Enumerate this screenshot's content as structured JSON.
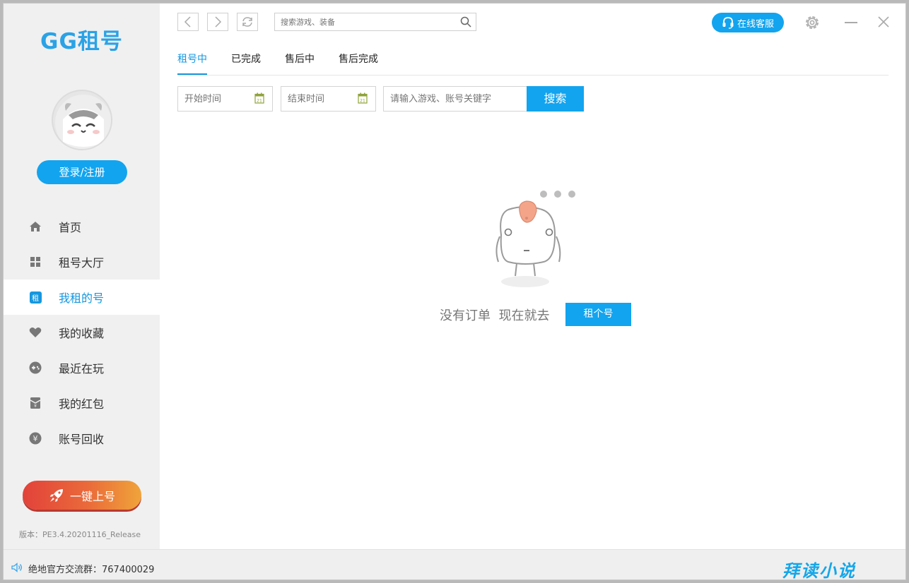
{
  "app": {
    "logo": "GG租号"
  },
  "sidebar": {
    "login_label": "登录/注册",
    "items": [
      {
        "label": "首页",
        "icon": "home-icon"
      },
      {
        "label": "租号大厅",
        "icon": "grid-icon"
      },
      {
        "label": "我租的号",
        "icon": "rent-icon",
        "active": true,
        "icon_text": "租"
      },
      {
        "label": "我的收藏",
        "icon": "heart-icon"
      },
      {
        "label": "最近在玩",
        "icon": "gamepad-icon"
      },
      {
        "label": "我的红包",
        "icon": "red-envelope-icon"
      },
      {
        "label": "账号回收",
        "icon": "yen-coin-icon"
      }
    ],
    "one_key_label": "一键上号",
    "version": "版本：PE3.4.20201116_Release"
  },
  "topbar": {
    "search_placeholder": "搜索游戏、装备",
    "service_label": "在线客服"
  },
  "tabs": [
    {
      "label": "租号中",
      "active": true
    },
    {
      "label": "已完成"
    },
    {
      "label": "售后中"
    },
    {
      "label": "售后完成"
    }
  ],
  "filter": {
    "start_placeholder": "开始时间",
    "end_placeholder": "结束时间",
    "calendar_day": "21",
    "keyword_placeholder": "请输入游戏、账号关键字",
    "search_label": "搜索"
  },
  "empty": {
    "message": "没有订单  现在就去",
    "button_label": "租个号"
  },
  "bottom": {
    "group_text": "绝地官方交流群：767400029",
    "watermark": "拜读小说"
  },
  "colors": {
    "accent": "#12a4ef",
    "sidebar_bg": "#f0f0f0",
    "active_text": "#1597e0"
  }
}
